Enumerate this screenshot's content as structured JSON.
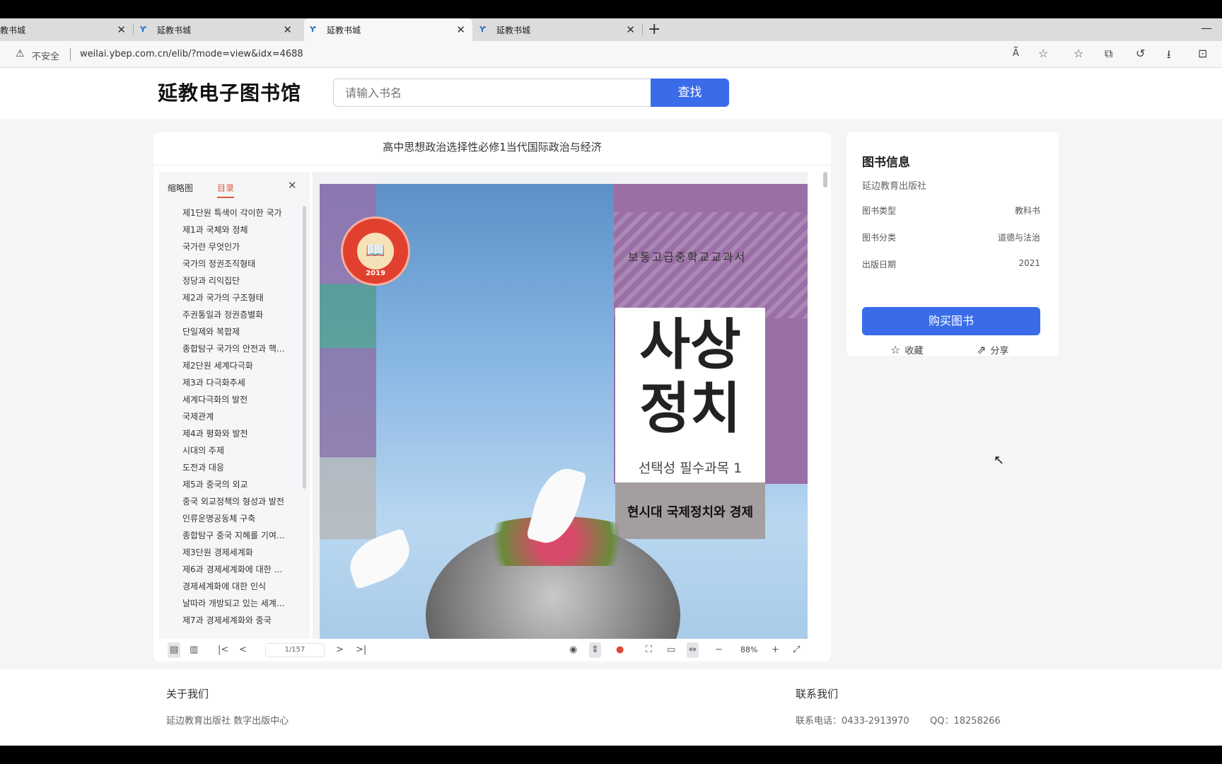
{
  "browser": {
    "tabs": [
      {
        "label": "教书城"
      },
      {
        "label": "延教书城"
      },
      {
        "label": "延教书城"
      },
      {
        "label": "延教书城"
      }
    ],
    "new_tab": "+",
    "security_label": "不安全",
    "url": "weilai.ybep.com.cn/elib/?mode=view&idx=4688"
  },
  "site": {
    "logo": "延教电子图书馆",
    "search_placeholder": "请输入书名",
    "search_button": "查找"
  },
  "reader": {
    "book_title": "高中思想政治选择性必修1当代国际政治与经济",
    "side_tabs": {
      "thumbnails": "缩略图",
      "toc": "目录"
    },
    "toc_items": [
      "제1단원 특색이 각이한 국가",
      "제1과 국체와 정체",
      "국가란 무엇인가",
      "국가의 정권조직형태",
      "정당과 리익집단",
      "제2과 국가의 구조형태",
      "주권통일과 정권층별화",
      "단일제와 복합제",
      "종합탐구 국가의 안전과 핵…",
      "제2단원 세계다극화",
      "제3과 다극화추세",
      "세계다극화의 발전",
      "국제관계",
      "제4과 평화와 발전",
      "시대의 주제",
      "도전과 대응",
      "제5과 중국의 외교",
      "중국 외교정책의 형성과 발전",
      "인류운명공동체 구축",
      "종합탐구 중국 지혜를 기여…",
      "제3단원 경제세계화",
      "제6과 경제세계화에 대한 …",
      "경제세계화에 대한 인식",
      "날따라 개방되고 있는 세계…",
      "제7과 경제세계화와 중국"
    ],
    "cover": {
      "publisher_line": "보통고급중학교교과서",
      "title_line1": "사상",
      "title_line2": "정치",
      "subtitle": "선택성 필수과목 1",
      "volume_title": "현시대 국제정치와 경제",
      "seal_year": "2019"
    },
    "page_indicator": "1/157",
    "zoom": "88%"
  },
  "info": {
    "title": "图书信息",
    "publisher": "延边教育出版社",
    "fields": [
      {
        "key": "图书类型",
        "value": "教科书"
      },
      {
        "key": "图书分类",
        "value": "道德与法治"
      },
      {
        "key": "出版日期",
        "value": "2021"
      }
    ],
    "buy_button": "购买图书",
    "favorite": "收藏",
    "share": "分享"
  },
  "footer": {
    "about_heading": "关于我们",
    "about_text": "延边教育出版社 数字出版中心",
    "contact_heading": "联系我们",
    "phone": "联系电话：0433-2913970",
    "qq": "QQ：18258266"
  },
  "colors": {
    "accent": "#3a6ce9",
    "toc_active": "#e05a3a"
  }
}
